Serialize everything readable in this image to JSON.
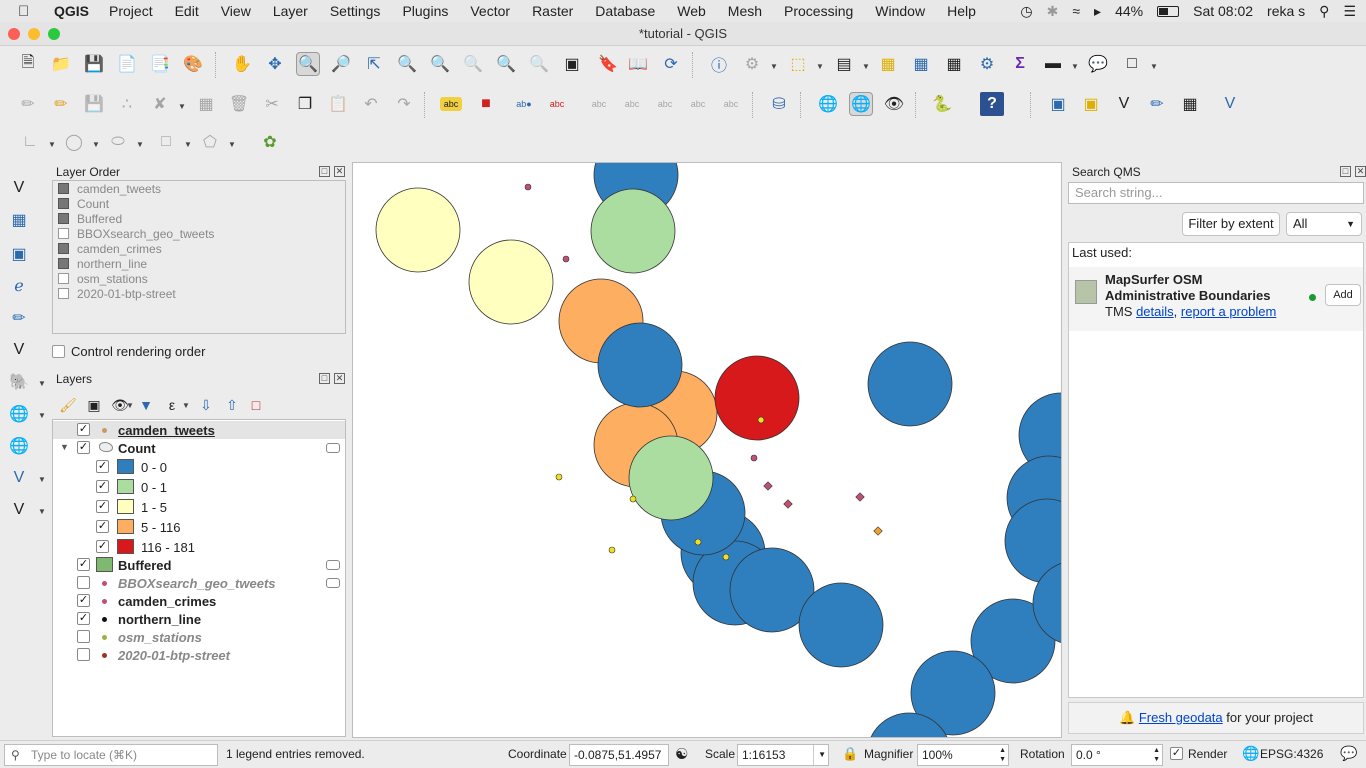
{
  "menubar": {
    "app": "QGIS",
    "items": [
      "Project",
      "Edit",
      "View",
      "Layer",
      "Settings",
      "Plugins",
      "Vector",
      "Raster",
      "Database",
      "Web",
      "Mesh",
      "Processing",
      "Window",
      "Help"
    ],
    "battery": "44%",
    "clock": "Sat 08:02",
    "user": "reka s"
  },
  "window": {
    "title": "*tutorial - QGIS"
  },
  "layer_order": {
    "title": "Layer Order",
    "items": [
      "camden_tweets",
      "Count",
      "Buffered",
      "BBOXsearch_geo_tweets",
      "camden_crimes",
      "northern_line",
      "osm_stations",
      "2020-01-btp-street"
    ],
    "control_rendering": "Control rendering order"
  },
  "layers": {
    "title": "Layers",
    "tree": {
      "camden_tweets": "camden_tweets",
      "count": "Count",
      "classes": [
        {
          "label": "0 - 0",
          "color": "#2f7fbf"
        },
        {
          "label": "0 - 1",
          "color": "#acdda0"
        },
        {
          "label": "1 - 5",
          "color": "#ffffbf"
        },
        {
          "label": "5 - 116",
          "color": "#fdae61"
        },
        {
          "label": "116 - 181",
          "color": "#d7191c"
        }
      ],
      "buffered": "Buffered",
      "bbox": "BBOXsearch_geo_tweets",
      "crimes": "camden_crimes",
      "northern": "northern_line",
      "osm": "osm_stations",
      "btp": "2020-01-btp-street"
    }
  },
  "qms": {
    "title": "Search QMS",
    "search_placeholder": "Search string...",
    "filter_button": "Filter by extent",
    "select_value": "All",
    "last_used": "Last used:",
    "service_name": "MapSurfer OSM Administrative Boundaries",
    "service_type": "TMS",
    "details": "details",
    "comma": ",",
    "report": "report a problem",
    "add": "Add",
    "fresh": "Fresh geodata",
    "fresh_suffix": "for your project"
  },
  "status": {
    "locate_placeholder": "Type to locate (⌘K)",
    "message": "1 legend entries removed.",
    "coordinate_label": "Coordinate",
    "coordinate": "-0.0875,51.4957",
    "scale_label": "Scale",
    "scale": "1:16153",
    "magnifier_label": "Magnifier",
    "magnifier": "100%",
    "rotation_label": "Rotation",
    "rotation": "0.0 °",
    "render": "Render",
    "crs": "EPSG:4326"
  },
  "colors": {
    "blue": "#2f7fbf",
    "green": "#acdda0",
    "yellow": "#ffffbf",
    "orange": "#fdae61",
    "red": "#d7191c",
    "buffered": "#7fb870"
  }
}
